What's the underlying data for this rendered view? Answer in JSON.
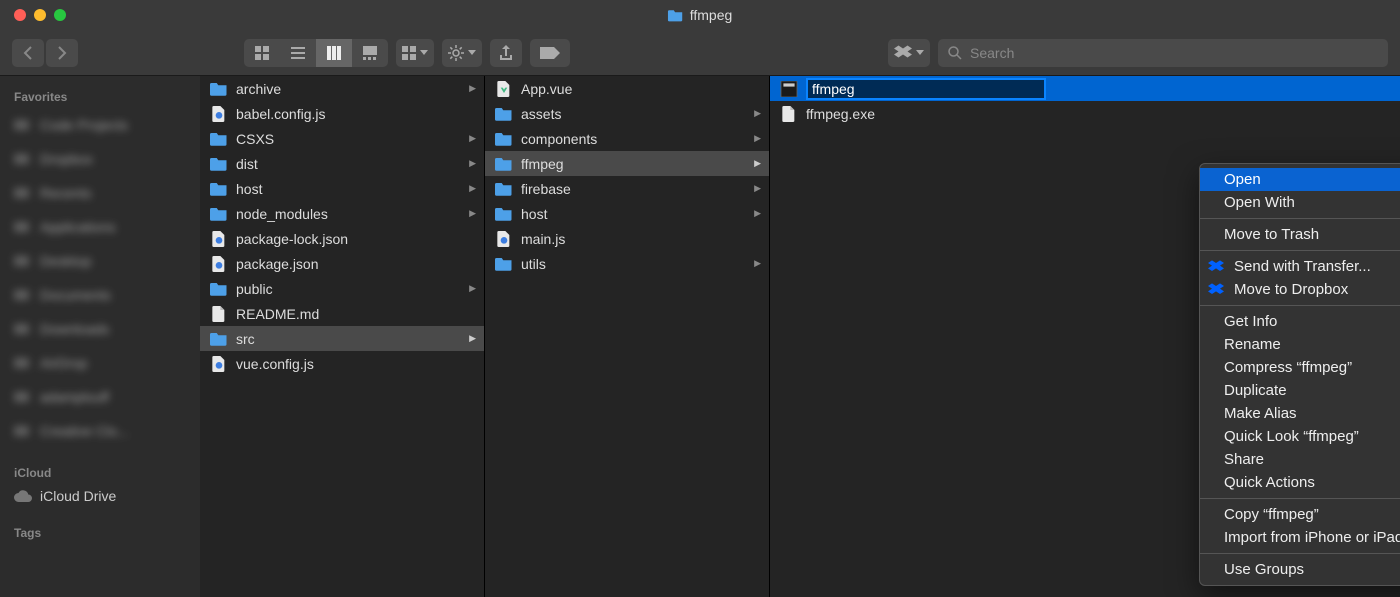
{
  "window": {
    "title": "ffmpeg"
  },
  "search": {
    "placeholder": "Search"
  },
  "sidebar": {
    "section_favorites": "Favorites",
    "section_icloud": "iCloud",
    "section_tags": "Tags",
    "icloud_drive": "iCloud Drive",
    "blurred_items": [
      "Code Projects",
      "Dropbox",
      "Recents",
      "Applications",
      "Desktop",
      "Documents",
      "Downloads",
      "AirDrop",
      "adamplouff",
      "Creative Clo..."
    ]
  },
  "columns": [
    {
      "items": [
        {
          "name": "archive",
          "type": "folder",
          "children": true
        },
        {
          "name": "babel.config.js",
          "type": "js"
        },
        {
          "name": "CSXS",
          "type": "folder",
          "children": true
        },
        {
          "name": "dist",
          "type": "folder",
          "children": true
        },
        {
          "name": "host",
          "type": "folder",
          "children": true
        },
        {
          "name": "node_modules",
          "type": "folder",
          "children": true
        },
        {
          "name": "package-lock.json",
          "type": "json"
        },
        {
          "name": "package.json",
          "type": "json"
        },
        {
          "name": "public",
          "type": "folder",
          "children": true
        },
        {
          "name": "README.md",
          "type": "md"
        },
        {
          "name": "src",
          "type": "folder",
          "children": true,
          "selected": true
        },
        {
          "name": "vue.config.js",
          "type": "js"
        }
      ]
    },
    {
      "items": [
        {
          "name": "App.vue",
          "type": "vue"
        },
        {
          "name": "assets",
          "type": "folder",
          "children": true
        },
        {
          "name": "components",
          "type": "folder",
          "children": true
        },
        {
          "name": "ffmpeg",
          "type": "folder",
          "children": true,
          "selected": true
        },
        {
          "name": "firebase",
          "type": "folder",
          "children": true
        },
        {
          "name": "host",
          "type": "folder",
          "children": true
        },
        {
          "name": "main.js",
          "type": "js"
        },
        {
          "name": "utils",
          "type": "folder",
          "children": true
        }
      ]
    },
    {
      "items": [
        {
          "name": "ffmpeg",
          "type": "exec",
          "highlighted": true
        },
        {
          "name": "ffmpeg.exe",
          "type": "file"
        }
      ]
    }
  ],
  "context_menu": {
    "groups": [
      [
        {
          "label": "Open",
          "highlighted": true
        },
        {
          "label": "Open With",
          "submenu": true
        }
      ],
      [
        {
          "label": "Move to Trash"
        }
      ],
      [
        {
          "label": "Send with Transfer...",
          "icon": "dropbox"
        },
        {
          "label": "Move to Dropbox",
          "icon": "dropbox"
        }
      ],
      [
        {
          "label": "Get Info"
        },
        {
          "label": "Rename"
        },
        {
          "label": "Compress “ffmpeg”"
        },
        {
          "label": "Duplicate"
        },
        {
          "label": "Make Alias"
        },
        {
          "label": "Quick Look “ffmpeg”"
        },
        {
          "label": "Share",
          "submenu": true
        },
        {
          "label": "Quick Actions",
          "submenu": true
        }
      ],
      [
        {
          "label": "Copy “ffmpeg”"
        },
        {
          "label": "Import from iPhone or iPad",
          "submenu": true
        }
      ],
      [
        {
          "label": "Use Groups"
        }
      ]
    ]
  }
}
